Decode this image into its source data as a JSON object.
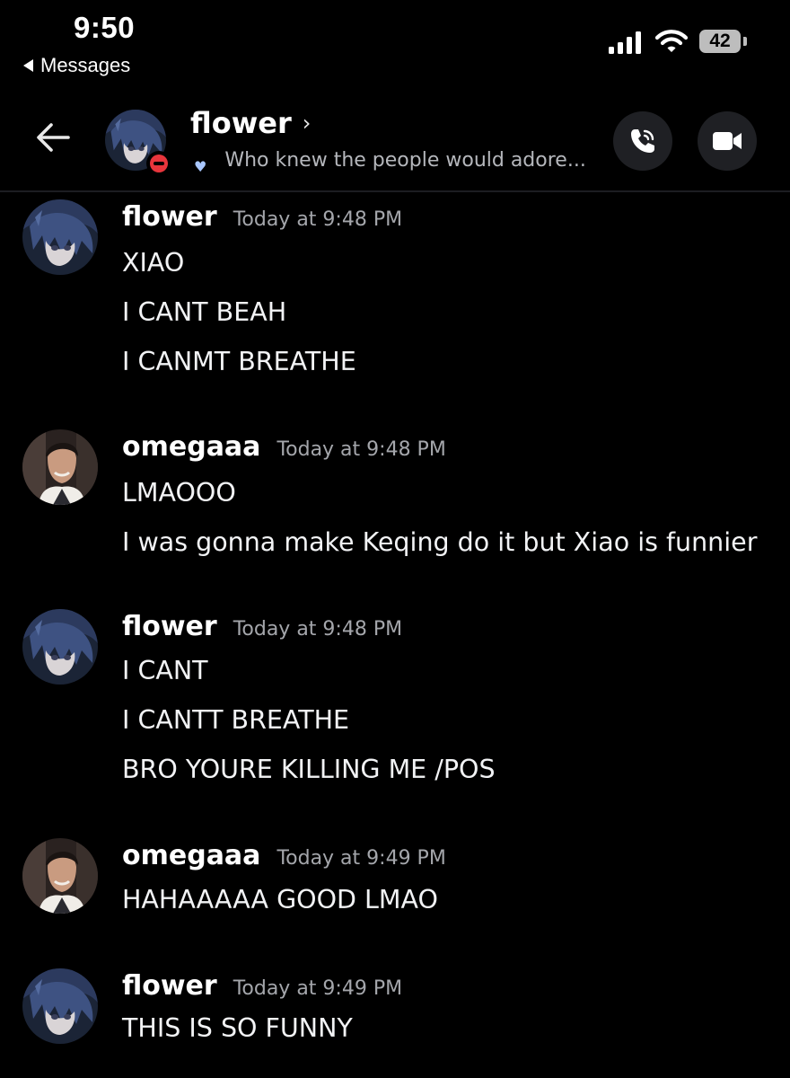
{
  "status_bar": {
    "time": "9:50",
    "back_app_label": "Messages",
    "battery_level": "42"
  },
  "header": {
    "channel_name": "flower",
    "status_text": "Who knew the people would adore..."
  },
  "colors": {
    "background": "#000000",
    "dnd_status": "#e8353c",
    "timestamp": "#a4a6ab",
    "button_bg": "#1f2024"
  },
  "messages": [
    {
      "author": "flower",
      "timestamp": "Today at 9:48 PM",
      "avatar": "flower-avatar",
      "lines": [
        "XIAO",
        "I CANT BEAH",
        "I CANMT BREATHE"
      ]
    },
    {
      "author": "omegaaa",
      "timestamp": "Today at 9:48 PM",
      "avatar": "omegaaa-avatar",
      "lines": [
        "LMAOOO",
        "I was gonna make Keqing do it but Xiao is funnier"
      ]
    },
    {
      "author": "flower",
      "timestamp": "Today at 9:48 PM",
      "avatar": "flower-avatar",
      "lines": [
        "I CANT",
        "I CANTT BREATHE",
        "BRO YOURE KILLING ME /POS"
      ]
    },
    {
      "author": "omegaaa",
      "timestamp": "Today at 9:49 PM",
      "avatar": "omegaaa-avatar",
      "lines": [
        "HAHAAAAA GOOD LMAO"
      ]
    },
    {
      "author": "flower",
      "timestamp": "Today at 9:49 PM",
      "avatar": "flower-avatar",
      "lines": [
        "THIS IS SO FUNNY"
      ]
    }
  ]
}
